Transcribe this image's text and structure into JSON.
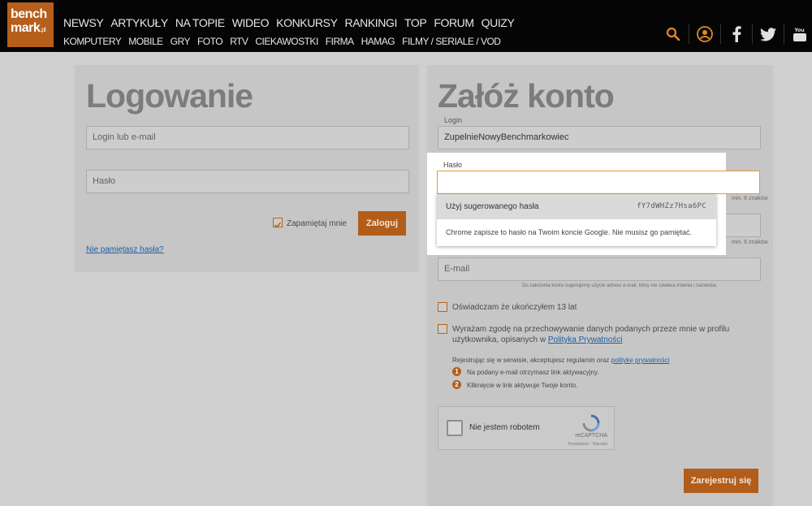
{
  "header": {
    "logo_line1": "bench",
    "logo_line2": "mark",
    "logo_suffix": ".pl",
    "nav_primary": [
      "NEWSY",
      "ARTYKUŁY",
      "NA TOPIE",
      "WIDEO",
      "KONKURSY",
      "RANKINGI",
      "TOP",
      "FORUM",
      "QUIZY"
    ],
    "nav_secondary": [
      "KOMPUTERY",
      "MOBILE",
      "GRY",
      "FOTO",
      "RTV",
      "CIEKAWOSTKI",
      "FIRMA",
      "HAMAG",
      "FILMY / SERIALE / VOD"
    ],
    "accent_color": "#e0892a",
    "icons": [
      "search-icon",
      "user-icon",
      "facebook-icon",
      "twitter-icon",
      "youtube-icon"
    ]
  },
  "login": {
    "title": "Logowanie",
    "login_placeholder": "Login lub e-mail",
    "password_placeholder": "Hasło",
    "remember_label": "Zapamiętaj mnie",
    "submit_label": "Zaloguj",
    "forgot_link": "Nie pamiętasz hasła?"
  },
  "register": {
    "title": "Załóż konto",
    "login_label": "Login",
    "login_value": "ZupelnieNowyBenchmarkowiec",
    "password_hint": "min. 8 znaków",
    "password_confirm_hint": "min. 8 znaków",
    "email_placeholder": "E-mail",
    "email_hint": "Do założenia konta sugerujemy użycie adresu e-mail, który nie zawiera imienia i nazwiska.",
    "age_label": "Oświadczam że ukończyłem 13 lat",
    "consent_text": "Wyrażam zgodę na przechowywanie danych podanych przeze mnie w profilu",
    "consent_text2": "użytkownika, opisanych w",
    "privacy_link": "Polityka Prywatności",
    "rules_text": "Rejestrując się w serwisie, akceptujesz regulamin oraz",
    "rules_link": "politykę prywatności",
    "step1_num": "1",
    "step1": "Na podany e-mail otrzymasz link aktywacyjny.",
    "step2_num": "2",
    "step2": "Kliknięcie w link aktywuje Twoje konto.",
    "recaptcha_label": "Nie jestem robotem",
    "recaptcha_brand": "reCAPTCHA",
    "recaptcha_terms": "Prywatność - Warunki",
    "submit_label": "Zarejestruj się"
  },
  "autofill": {
    "password_label": "Hasło",
    "suggest_label": "Użyj sugerowanego hasła",
    "suggested_password": "fY7dWHZz7Hsa6PC",
    "note": "Chrome zapisze to hasło na Twoim koncie Google. Nie musisz go pamiętać."
  }
}
